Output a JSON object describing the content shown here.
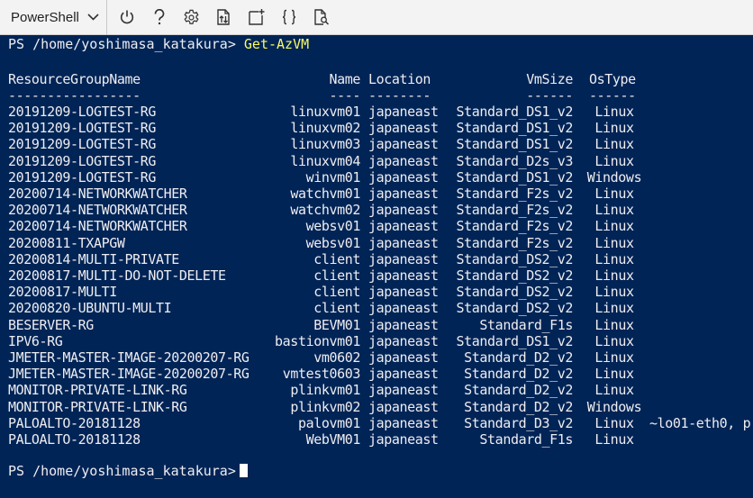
{
  "toolbar": {
    "shell_label": "PowerShell",
    "icons": [
      "chevron-down-icon",
      "power-icon",
      "help-icon",
      "gear-icon",
      "upload-download-icon",
      "new-session-icon",
      "braces-icon",
      "web-preview-icon"
    ]
  },
  "terminal": {
    "prompt": "PS /home/yoshimasa_katakura>",
    "command": "Get-AzVM",
    "headers": {
      "resource_group": "ResourceGroupName",
      "name": "Name",
      "location": "Location",
      "vm_size": "VmSize",
      "os_type": "OsType"
    },
    "dashes": {
      "resource_group": "-----------------",
      "name": "----",
      "location": "--------",
      "vm_size": "------",
      "os_type": "------"
    },
    "rows": [
      {
        "resource_group": "20191209-LOGTEST-RG",
        "name": "linuxvm01",
        "location": "japaneast",
        "vm_size": "Standard_DS1_v2",
        "os_type": "Linux"
      },
      {
        "resource_group": "20191209-LOGTEST-RG",
        "name": "linuxvm02",
        "location": "japaneast",
        "vm_size": "Standard_DS1_v2",
        "os_type": "Linux"
      },
      {
        "resource_group": "20191209-LOGTEST-RG",
        "name": "linuxvm03",
        "location": "japaneast",
        "vm_size": "Standard_DS1_v2",
        "os_type": "Linux"
      },
      {
        "resource_group": "20191209-LOGTEST-RG",
        "name": "linuxvm04",
        "location": "japaneast",
        "vm_size": "Standard_D2s_v3",
        "os_type": "Linux"
      },
      {
        "resource_group": "20191209-LOGTEST-RG",
        "name": "winvm01",
        "location": "japaneast",
        "vm_size": "Standard_DS1_v2",
        "os_type": "Windows"
      },
      {
        "resource_group": "20200714-NETWORKWATCHER",
        "name": "watchvm01",
        "location": "japaneast",
        "vm_size": "Standard_F2s_v2",
        "os_type": "Linux"
      },
      {
        "resource_group": "20200714-NETWORKWATCHER",
        "name": "watchvm02",
        "location": "japaneast",
        "vm_size": "Standard_F2s_v2",
        "os_type": "Linux"
      },
      {
        "resource_group": "20200714-NETWORKWATCHER",
        "name": "websv01",
        "location": "japaneast",
        "vm_size": "Standard_F2s_v2",
        "os_type": "Linux"
      },
      {
        "resource_group": "20200811-TXAPGW",
        "name": "websv01",
        "location": "japaneast",
        "vm_size": "Standard_F2s_v2",
        "os_type": "Linux"
      },
      {
        "resource_group": "20200814-MULTI-PRIVATE",
        "name": "client",
        "location": "japaneast",
        "vm_size": "Standard_DS2_v2",
        "os_type": "Linux"
      },
      {
        "resource_group": "20200817-MULTI-DO-NOT-DELETE",
        "name": "client",
        "location": "japaneast",
        "vm_size": "Standard_DS2_v2",
        "os_type": "Linux"
      },
      {
        "resource_group": "20200817-MULTI",
        "name": "client",
        "location": "japaneast",
        "vm_size": "Standard_DS2_v2",
        "os_type": "Linux"
      },
      {
        "resource_group": "20200820-UBUNTU-MULTI",
        "name": "client",
        "location": "japaneast",
        "vm_size": "Standard_DS2_v2",
        "os_type": "Linux"
      },
      {
        "resource_group": "BESERVER-RG",
        "name": "BEVM01",
        "location": "japaneast",
        "vm_size": "Standard_F1s",
        "os_type": "Linux"
      },
      {
        "resource_group": "IPV6-RG",
        "name": "bastionvm01",
        "location": "japaneast",
        "vm_size": "Standard_DS1_v2",
        "os_type": "Linux"
      },
      {
        "resource_group": "JMETER-MASTER-IMAGE-20200207-RG",
        "name": "vm0602",
        "location": "japaneast",
        "vm_size": "Standard_D2_v2",
        "os_type": "Linux"
      },
      {
        "resource_group": "JMETER-MASTER-IMAGE-20200207-RG",
        "name": "vmtest0603",
        "location": "japaneast",
        "vm_size": "Standard_D2_v2",
        "os_type": "Linux"
      },
      {
        "resource_group": "MONITOR-PRIVATE-LINK-RG",
        "name": "plinkvm01",
        "location": "japaneast",
        "vm_size": "Standard_D2_v2",
        "os_type": "Linux"
      },
      {
        "resource_group": "MONITOR-PRIVATE-LINK-RG",
        "name": "plinkvm02",
        "location": "japaneast",
        "vm_size": "Standard_D2_v2",
        "os_type": "Windows"
      },
      {
        "resource_group": "PALOALTO-20181128",
        "name": "palovm01",
        "location": "japaneast",
        "vm_size": "Standard_D3_v2",
        "os_type": "Linux"
      },
      {
        "resource_group": "PALOALTO-20181128",
        "name": "WebVM01",
        "location": "japaneast",
        "vm_size": "Standard_F1s",
        "os_type": "Linux"
      }
    ],
    "overflow_text": "~lo01-eth0, p"
  }
}
